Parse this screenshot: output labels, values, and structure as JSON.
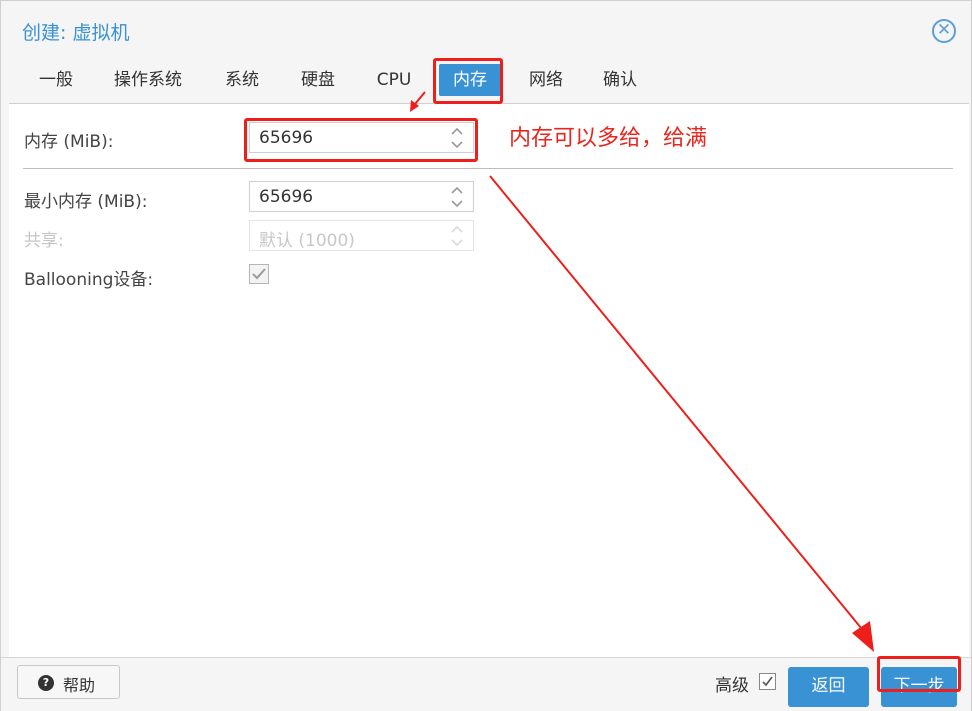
{
  "window": {
    "title": "创建: 虚拟机"
  },
  "tabs": [
    {
      "label": "一般"
    },
    {
      "label": "操作系统"
    },
    {
      "label": "系统"
    },
    {
      "label": "硬盘"
    },
    {
      "label": "CPU"
    },
    {
      "label": "内存",
      "active": true
    },
    {
      "label": "网络"
    },
    {
      "label": "确认"
    }
  ],
  "form": {
    "memory_label": "内存 (MiB):",
    "memory_value": "65696",
    "min_memory_label": "最小内存 (MiB):",
    "min_memory_value": "65696",
    "shares_label": "共享:",
    "shares_value": "默认 (1000)",
    "ballooning_label": "Ballooning设备:",
    "ballooning_checked": true
  },
  "annotation": {
    "text": "内存可以多给，给满"
  },
  "footer": {
    "help_label": "帮助",
    "advanced_label": "高级",
    "advanced_checked": true,
    "back_label": "返回",
    "next_label": "下一步"
  },
  "colors": {
    "accent": "#3892d4",
    "annotation_red": "#ee1f1a"
  }
}
